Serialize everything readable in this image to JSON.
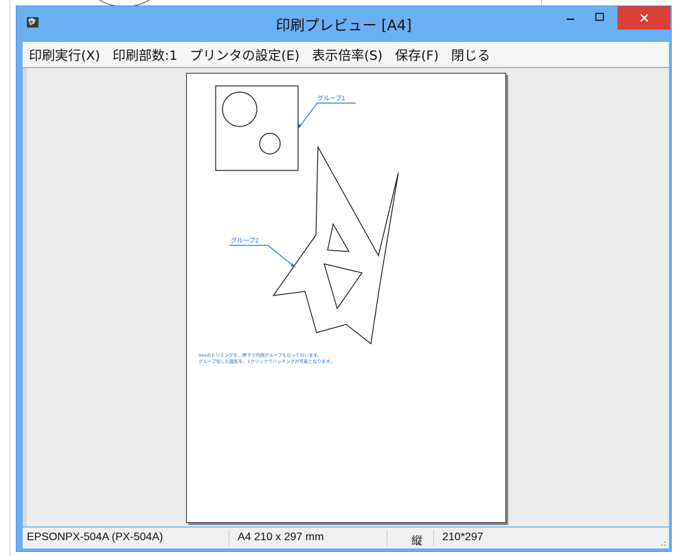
{
  "window": {
    "title": "印刷プレビュー [A4]",
    "close_glyph": "×",
    "min_glyph": "–",
    "max_glyph": "☐"
  },
  "menu": {
    "items": [
      {
        "label": "印刷実行(X)"
      },
      {
        "label": "印刷部数:1"
      },
      {
        "label": "プリンタの設定(E)"
      },
      {
        "label": "表示倍率(S)"
      },
      {
        "label": "保存(F)"
      },
      {
        "label": "閉じる"
      }
    ]
  },
  "preview": {
    "group1_label": "グループ1",
    "group2_label": "グループ2",
    "note_line1": "Vexのトリミングを、押下で内側グループを以って行います。",
    "note_line2": "グループ化した図形を、1クリックでハッチングが可能となります。"
  },
  "status": {
    "printer": "EPSONPX-504A (PX-504A)",
    "paper": "A4 210 x 297 mm",
    "orientation": "縦",
    "size": "210*297"
  },
  "colors": {
    "titlebar": "#6ab0f3",
    "close_button": "#d9403a",
    "annotation_blue": "#1c6fe0"
  }
}
